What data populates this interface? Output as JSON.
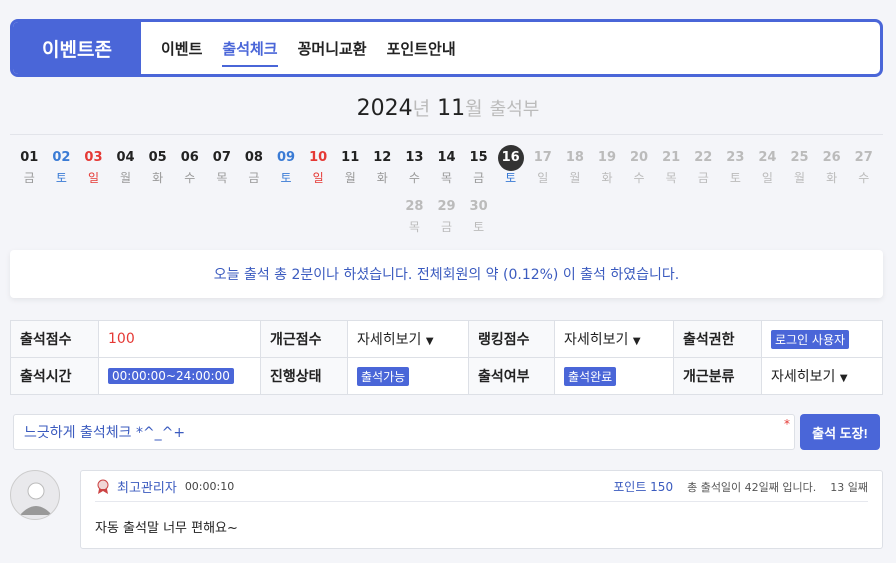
{
  "brand": "이벤트존",
  "nav": [
    {
      "label": "이벤트",
      "active": false
    },
    {
      "label": "출석체크",
      "active": true
    },
    {
      "label": "꽁머니교환",
      "active": false
    },
    {
      "label": "포인트안내",
      "active": false
    }
  ],
  "month": {
    "year": "2024",
    "year_unit": "년",
    "month": "11",
    "month_unit": "월",
    "suffix": "출석부"
  },
  "calendar": [
    {
      "num": "01",
      "wd": "금",
      "kind": "past"
    },
    {
      "num": "02",
      "wd": "토",
      "kind": "sat"
    },
    {
      "num": "03",
      "wd": "일",
      "kind": "sun"
    },
    {
      "num": "04",
      "wd": "월",
      "kind": "past"
    },
    {
      "num": "05",
      "wd": "화",
      "kind": "past"
    },
    {
      "num": "06",
      "wd": "수",
      "kind": "past"
    },
    {
      "num": "07",
      "wd": "목",
      "kind": "past"
    },
    {
      "num": "08",
      "wd": "금",
      "kind": "past"
    },
    {
      "num": "09",
      "wd": "토",
      "kind": "sat"
    },
    {
      "num": "10",
      "wd": "일",
      "kind": "sun"
    },
    {
      "num": "11",
      "wd": "월",
      "kind": "past"
    },
    {
      "num": "12",
      "wd": "화",
      "kind": "past"
    },
    {
      "num": "13",
      "wd": "수",
      "kind": "past"
    },
    {
      "num": "14",
      "wd": "목",
      "kind": "past"
    },
    {
      "num": "15",
      "wd": "금",
      "kind": "past"
    },
    {
      "num": "16",
      "wd": "토",
      "kind": "today"
    },
    {
      "num": "17",
      "wd": "일",
      "kind": "future"
    },
    {
      "num": "18",
      "wd": "월",
      "kind": "future"
    },
    {
      "num": "19",
      "wd": "화",
      "kind": "future"
    },
    {
      "num": "20",
      "wd": "수",
      "kind": "future"
    },
    {
      "num": "21",
      "wd": "목",
      "kind": "future"
    },
    {
      "num": "22",
      "wd": "금",
      "kind": "future"
    },
    {
      "num": "23",
      "wd": "토",
      "kind": "future"
    },
    {
      "num": "24",
      "wd": "일",
      "kind": "future"
    },
    {
      "num": "25",
      "wd": "월",
      "kind": "future"
    },
    {
      "num": "26",
      "wd": "화",
      "kind": "future"
    },
    {
      "num": "27",
      "wd": "수",
      "kind": "future"
    },
    {
      "num": "28",
      "wd": "목",
      "kind": "future"
    },
    {
      "num": "29",
      "wd": "금",
      "kind": "future"
    },
    {
      "num": "30",
      "wd": "토",
      "kind": "future"
    }
  ],
  "notice": "오늘 출석 총 2분이나 하셨습니다. 전체회원의 약 (0.12%) 이 출석 하였습니다.",
  "info": {
    "score_label": "출석점수",
    "score_value": "100",
    "personal_label": "개근점수",
    "personal_value": "자세히보기",
    "ranking_label": "랭킹점수",
    "ranking_value": "자세히보기",
    "perm_label": "출석권한",
    "perm_value": "로그인 사용자",
    "time_label": "출석시간",
    "time_value": "00:00:00~24:00:00",
    "status_label": "진행상태",
    "status_value": "출석가능",
    "done_label": "출석여부",
    "done_value": "출석완료",
    "class_label": "개근분류",
    "class_value": "자세히보기"
  },
  "checkin": {
    "placeholder": "느긋하게 출석체크 *^_^+",
    "required": "*",
    "submit": "출석 도장!"
  },
  "comment": {
    "name": "최고관리자",
    "time": "00:00:10",
    "point": "포인트 150",
    "total": "총 출석일이 42일째 입니다.",
    "streak": "13 일째",
    "body": "자동 출석말 너무 편해요~"
  },
  "colors": {
    "accent": "#4a66d8",
    "saturday": "#3a7bd5",
    "sunday": "#e53935"
  }
}
